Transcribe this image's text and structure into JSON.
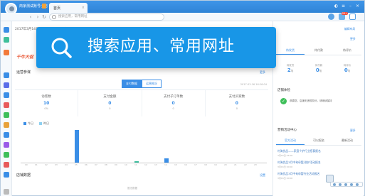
{
  "titlebar": {
    "shop_name": "商家测试账号小店",
    "tab_label": "首页",
    "tab_close": "×"
  },
  "addressbar": {
    "placeholder": "搜索应用，常用网址",
    "back": "‹",
    "forward": "›",
    "refresh": "↻",
    "badge_count": "99+"
  },
  "main": {
    "date_range": "2017年3月14日（星期二）-2017年03月16日",
    "promo_text": "千牛大促",
    "overview_title": "运营参谋",
    "overview_more": "更多",
    "toggle_realtime": "支付数据",
    "toggle_history": "运营概况",
    "update_stamp": "2017-03-16 16:26:04",
    "metrics": [
      {
        "label": "访客数",
        "value": "10",
        "sub": "0%"
      },
      {
        "label": "支付金额",
        "value": "0",
        "sub": "0"
      },
      {
        "label": "支付子订单数",
        "value": "0",
        "sub": "0"
      },
      {
        "label": "支付买家数",
        "value": "0",
        "sub": "0"
      }
    ],
    "footer_title": "店铺数据",
    "footer_more": "设置",
    "footer_empty": "暂无数据"
  },
  "chart_data": {
    "type": "bar",
    "series": [
      {
        "name": "今日",
        "color": "#3a8ee6",
        "values": [
          1,
          0,
          0,
          0,
          0,
          0,
          0,
          0,
          0,
          0,
          0,
          0,
          0,
          0,
          0,
          0,
          0,
          0,
          0,
          0,
          0,
          0,
          0,
          0
        ]
      },
      {
        "name": "昨日",
        "color": "#8fd0f0",
        "values": [
          0,
          0,
          0,
          0,
          0,
          0,
          0,
          0,
          0,
          0,
          0,
          0,
          0,
          0,
          0,
          0,
          0,
          0,
          0,
          0,
          0,
          0,
          0,
          0
        ]
      }
    ],
    "highlight_bars": [
      {
        "index": 5,
        "value": 8
      },
      {
        "index": 11,
        "value": 0.4
      },
      {
        "index": 14,
        "value": 1
      }
    ],
    "categories": [
      "00",
      "01",
      "02",
      "03",
      "04",
      "05",
      "06",
      "07",
      "08",
      "09",
      "10",
      "11",
      "12",
      "13",
      "14",
      "15",
      "16",
      "17",
      "18",
      "19",
      "20",
      "21",
      "22",
      "23"
    ],
    "ylim": [
      0,
      9
    ]
  },
  "rpanel": {
    "top_link": "编辑布局",
    "more": "更多",
    "tabs": [
      "待发货",
      "待付款",
      "待评价"
    ],
    "stats": [
      {
        "label": "待发货",
        "value": "2",
        "unit": "笔"
      },
      {
        "label": "待付款",
        "value": "0",
        "unit": "笔"
      },
      {
        "label": "待评价",
        "value": "0",
        "unit": "笔"
      }
    ],
    "check_title": "店铺体检",
    "check_text": "恭喜您，店铺无违规扣分，请继续保持",
    "marketing_title": "营销活动中心",
    "marketing_more": "更多",
    "mtabs": [
      "官方活动",
      "可以报名",
      "最新活动"
    ],
    "news": [
      {
        "title": "村淘优品——家庭个护行业招募报名",
        "date": "3月16日 04:00"
      },
      {
        "title": "村淘优品3月中旬母婴/洗护活动报名",
        "date": "3月16日 00:00"
      },
      {
        "title": "村淘优品3月中旬母婴行业活动报名",
        "date": "3月16日 00:00"
      }
    ]
  },
  "overlay": {
    "text": "搜索应用、常用网址"
  }
}
